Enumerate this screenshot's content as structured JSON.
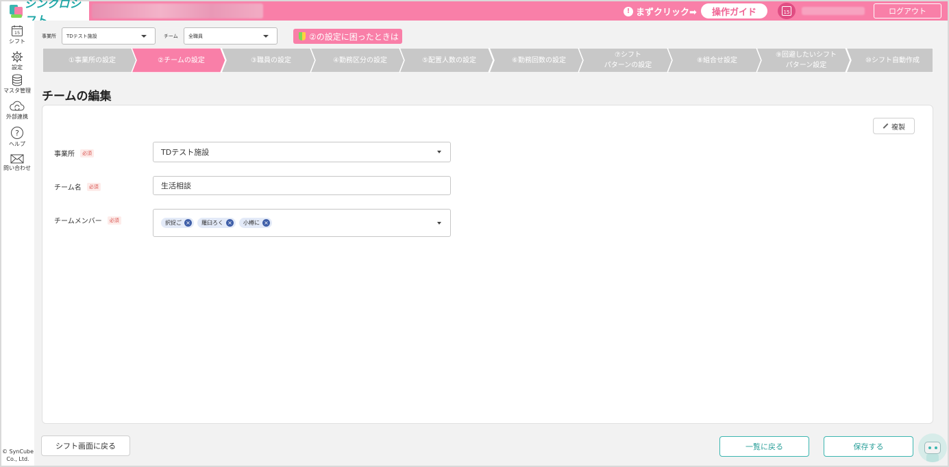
{
  "header": {
    "logo_text": "シンクロシフト",
    "mazu_text": "まずクリック➡",
    "guide_label": "操作ガイド",
    "calendar_day": "15",
    "logout_label": "ログアウト"
  },
  "sidebar": {
    "items": [
      {
        "label": "シフト",
        "icon": "calendar-icon",
        "day": "15"
      },
      {
        "label": "設定",
        "icon": "gear-icon"
      },
      {
        "label": "マスタ管理",
        "icon": "database-icon"
      },
      {
        "label": "外部連携",
        "icon": "cloud-sync-icon"
      },
      {
        "label": "ヘルプ",
        "icon": "help-icon"
      },
      {
        "label": "問い合わせ",
        "icon": "mail-icon"
      }
    ],
    "copyright_line1": "© SynCube",
    "copyright_line2": "Co., Ltd."
  },
  "filters": {
    "office_label": "事業所",
    "office_value": "TDテスト施設",
    "team_label": "チーム",
    "team_value": "全職員",
    "help_badge": "②の設定に困ったときは"
  },
  "steps": [
    {
      "line1": "①事業所の設定",
      "line2": "",
      "active": false
    },
    {
      "line1": "②チームの設定",
      "line2": "",
      "active": true
    },
    {
      "line1": "③職員の設定",
      "line2": "",
      "active": false
    },
    {
      "line1": "④勤務区分の設定",
      "line2": "",
      "active": false
    },
    {
      "line1": "⑤配置人数の設定",
      "line2": "",
      "active": false
    },
    {
      "line1": "⑥勤務回数の設定",
      "line2": "",
      "active": false
    },
    {
      "line1": "⑦シフト",
      "line2": "パターンの設定",
      "active": false
    },
    {
      "line1": "⑧組合せ設定",
      "line2": "",
      "active": false
    },
    {
      "line1": "⑨回避したいシフト",
      "line2": "パターン設定",
      "active": false
    },
    {
      "line1": "⑩シフト自動作成",
      "line2": "",
      "active": false
    }
  ],
  "colors": {
    "brand_pink": "#f97fa8",
    "step_gray": "#c8c8c8",
    "accent_teal": "#3bb6b0"
  },
  "page": {
    "title": "チームの編集",
    "copy_label": "複製"
  },
  "form": {
    "required_label": "必須",
    "office": {
      "label": "事業所",
      "value": "TDテスト施設"
    },
    "team_name": {
      "label": "チーム名",
      "value": "生活相談"
    },
    "members": {
      "label": "チームメンバー",
      "chips": [
        "択捉ご",
        "羅臼ろく",
        "小樽に"
      ]
    }
  },
  "footer": {
    "back_label": "シフト画面に戻る",
    "list_label": "一覧に戻る",
    "save_label": "保存する"
  }
}
